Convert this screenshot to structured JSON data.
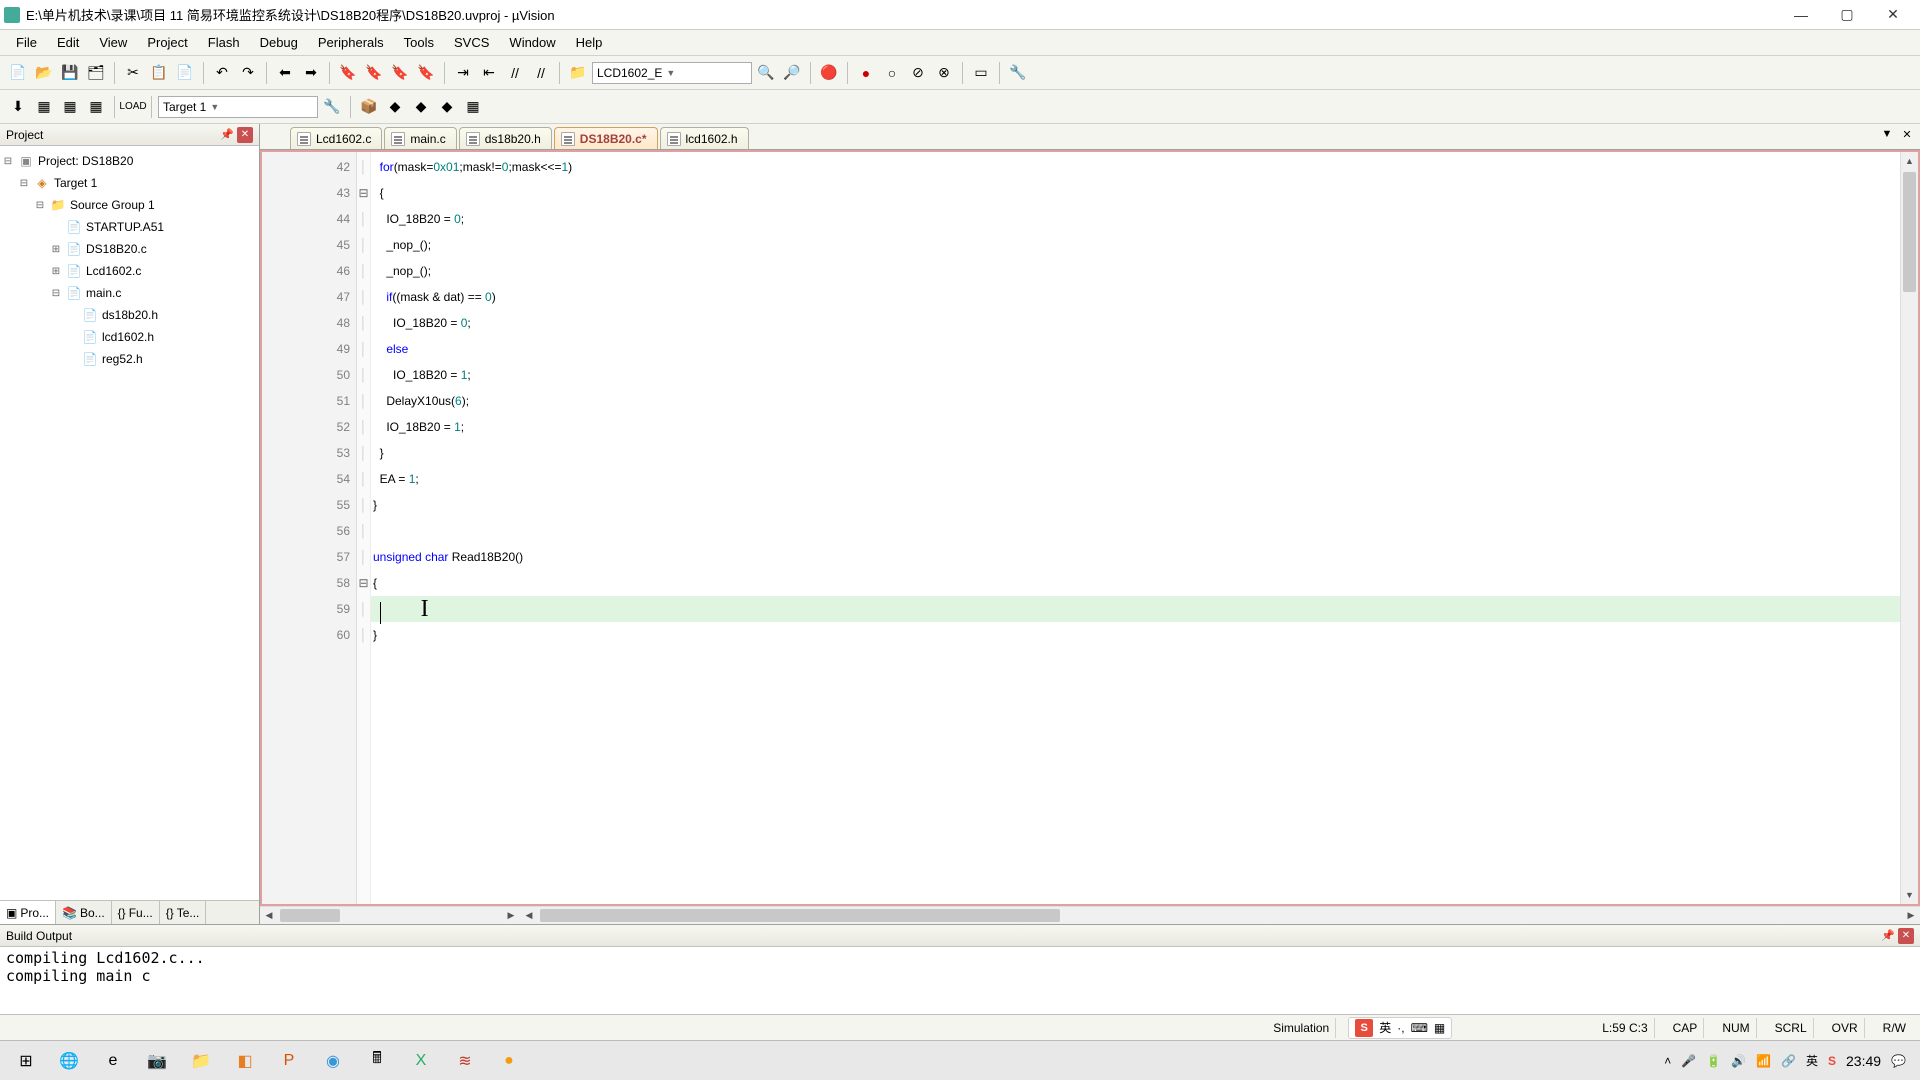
{
  "window": {
    "title": "E:\\单片机技术\\录课\\项目 11 简易环境监控系统设计\\DS18B20程序\\DS18B20.uvproj - µVision",
    "min": "—",
    "max": "▢",
    "close": "✕"
  },
  "menu": [
    "File",
    "Edit",
    "View",
    "Project",
    "Flash",
    "Debug",
    "Peripherals",
    "Tools",
    "SVCS",
    "Window",
    "Help"
  ],
  "toolbar": {
    "combo_search": "LCD1602_E",
    "combo_target": "Target 1"
  },
  "project_panel": {
    "title": "Project",
    "root": "Project: DS18B20",
    "target": "Target 1",
    "group": "Source Group 1",
    "files": [
      "STARTUP.A51",
      "DS18B20.c",
      "Lcd1602.c",
      "main.c"
    ],
    "subfiles": [
      "ds18b20.h",
      "lcd1602.h",
      "reg52.h"
    ],
    "tabs": [
      "Pro...",
      "Bo...",
      "Fu...",
      "Te..."
    ]
  },
  "editor": {
    "tabs": [
      {
        "label": "Lcd1602.c",
        "active": false
      },
      {
        "label": "main.c",
        "active": false
      },
      {
        "label": "ds18b20.h",
        "active": false
      },
      {
        "label": "DS18B20.c*",
        "active": true
      },
      {
        "label": "lcd1602.h",
        "active": false
      }
    ],
    "first_line": 42,
    "lines": [
      {
        "n": 42,
        "fold": "",
        "html": "  <span class='kw'>for</span>(mask=<span class='num'>0x01</span>;mask!=<span class='num'>0</span>;mask<<=<span class='num'>1</span>)"
      },
      {
        "n": 43,
        "fold": "⊟",
        "html": "  {"
      },
      {
        "n": 44,
        "fold": "",
        "html": "    IO_18B20 = <span class='num'>0</span>;"
      },
      {
        "n": 45,
        "fold": "",
        "html": "    _nop_();"
      },
      {
        "n": 46,
        "fold": "",
        "html": "    _nop_();"
      },
      {
        "n": 47,
        "fold": "",
        "html": "    <span class='kw'>if</span>((mask & dat) == <span class='num'>0</span>)"
      },
      {
        "n": 48,
        "fold": "",
        "html": "      IO_18B20 = <span class='num'>0</span>;"
      },
      {
        "n": 49,
        "fold": "",
        "html": "    <span class='kw'>else</span>"
      },
      {
        "n": 50,
        "fold": "",
        "html": "      IO_18B20 = <span class='num'>1</span>;"
      },
      {
        "n": 51,
        "fold": "",
        "html": "    DelayX10us(<span class='num'>6</span>);"
      },
      {
        "n": 52,
        "fold": "",
        "html": "    IO_18B20 = <span class='num'>1</span>;"
      },
      {
        "n": 53,
        "fold": "",
        "html": "  }"
      },
      {
        "n": 54,
        "fold": "",
        "html": "  EA = <span class='num'>1</span>;"
      },
      {
        "n": 55,
        "fold": "",
        "html": "}"
      },
      {
        "n": 56,
        "fold": "",
        "html": ""
      },
      {
        "n": 57,
        "fold": "",
        "html": "<span class='kw'>unsigned</span> <span class='kw'>char</span> Read18B20()"
      },
      {
        "n": 58,
        "fold": "⊟",
        "html": "{"
      },
      {
        "n": 59,
        "fold": "",
        "html": "  <span class='cursor'></span><span class='textcursor'>I</span>",
        "hl": true
      },
      {
        "n": 60,
        "fold": "",
        "html": "}"
      }
    ]
  },
  "build": {
    "title": "Build Output",
    "lines": [
      "compiling Lcd1602.c...",
      "compiling main c"
    ]
  },
  "status": {
    "mode": "Simulation",
    "ime_text": "英",
    "pos": "L:59 C:3",
    "caps": "CAP",
    "num": "NUM",
    "scrl": "SCRL",
    "ovr": "OVR",
    "rw": "R/W"
  },
  "taskbar": {
    "time": "23:49"
  }
}
